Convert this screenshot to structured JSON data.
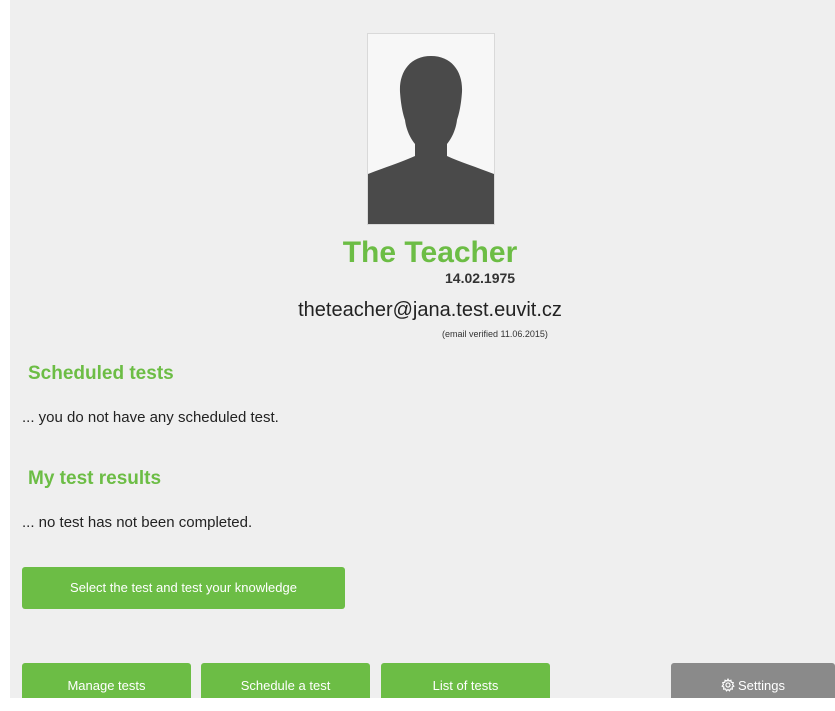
{
  "profile": {
    "name": "The Teacher",
    "birth_date": "14.02.1975",
    "email": "theteacher@jana.test.euvit.cz",
    "email_status": "(email verified 11.06.2015)"
  },
  "scheduled_tests": {
    "title": "Scheduled tests",
    "empty_text": "... you do not have any scheduled test."
  },
  "test_results": {
    "title": "My test results",
    "empty_text": "... no test has not been completed."
  },
  "actions": {
    "select_test_label": "Select the test and test your knowledge"
  },
  "bottom_bar": {
    "manage_tests_label": "Manage tests",
    "schedule_test_label": "Schedule a test",
    "list_tests_label": "List of tests",
    "settings_label": "Settings",
    "settings_icon": "gear-icon"
  },
  "colors": {
    "accent": "#6cbd45",
    "settings_button": "#8a8a8a",
    "panel_background": "#efefef",
    "avatar_silhouette": "#4a4a4a"
  }
}
